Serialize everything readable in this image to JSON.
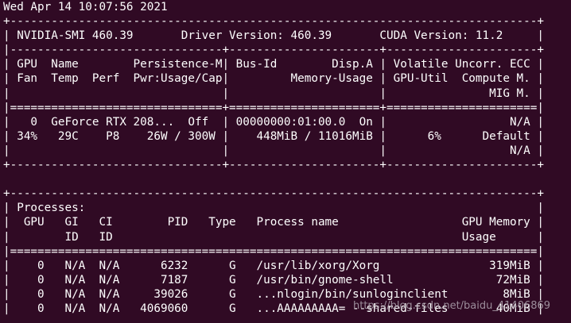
{
  "terminal": {
    "background": "#300a24",
    "foreground": "#ffffff",
    "lines": [
      "Wed Apr 14 10:07:56 2021",
      "+-----------------------------------------------------------------------------+",
      "| NVIDIA-SMI 460.39       Driver Version: 460.39       CUDA Version: 11.2     |",
      "|-------------------------------+----------------------+----------------------+",
      "| GPU  Name        Persistence-M| Bus-Id        Disp.A | Volatile Uncorr. ECC |",
      "| Fan  Temp  Perf  Pwr:Usage/Cap|         Memory-Usage | GPU-Util  Compute M. |",
      "|                               |                      |               MIG M. |",
      "|===============================+======================+======================|",
      "|   0  GeForce RTX 208...  Off  | 00000000:01:00.0  On |                  N/A |",
      "| 34%   29C    P8    26W / 300W |    448MiB / 11016MiB |      6%      Default |",
      "|                               |                      |                  N/A |",
      "+-------------------------------+----------------------+----------------------+",
      "",
      "+-----------------------------------------------------------------------------+",
      "| Processes:                                                                  |",
      "|  GPU   GI   CI        PID   Type   Process name                  GPU Memory |",
      "|        ID   ID                                                   Usage      |",
      "|=============================================================================|",
      "|    0   N/A  N/A      6232      G   /usr/lib/xorg/Xorg                319MiB |",
      "|    0   N/A  N/A      7187      G   /usr/bin/gnome-shell               72MiB |",
      "|    0   N/A  N/A     39026      G   ...nlogin/bin/sunloginclient        8MiB |",
      "|    0   N/A  N/A   4069060      G   ...AAAAAAAAA= --shared-files       40MiB |"
    ]
  },
  "watermark": {
    "text": "https://blog.csdn.net/baidu_41406869"
  }
}
